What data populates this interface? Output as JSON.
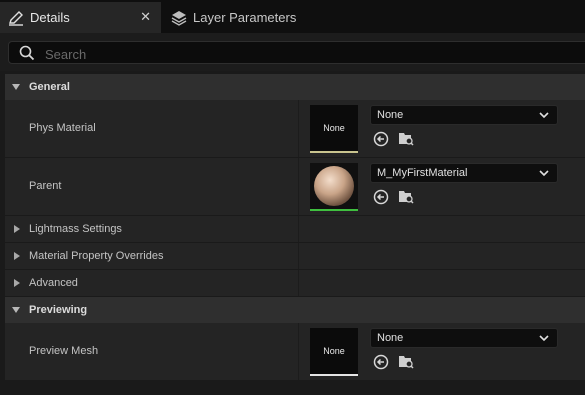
{
  "tabs": [
    {
      "label": "Details",
      "icon": "pencil-icon",
      "close": "✕"
    },
    {
      "label": "Layer Parameters",
      "icon": "layers-icon"
    }
  ],
  "search": {
    "placeholder": "Search",
    "value": ""
  },
  "sections": {
    "general": {
      "label": "General"
    },
    "previewing": {
      "label": "Previewing"
    }
  },
  "properties": {
    "phys_material": {
      "label": "Phys Material",
      "thumb_text": "None",
      "value": "None"
    },
    "parent": {
      "label": "Parent",
      "value": "M_MyFirstMaterial"
    },
    "lightmass": {
      "label": "Lightmass Settings"
    },
    "overrides": {
      "label": "Material Property Overrides"
    },
    "advanced": {
      "label": "Advanced"
    },
    "preview_mesh": {
      "label": "Preview Mesh",
      "thumb_text": "None",
      "value": "None"
    }
  },
  "colors": {
    "accent_phys": "#c9c48f",
    "accent_parent": "#3fbf3f",
    "accent_mesh": "#e6e6e6"
  }
}
